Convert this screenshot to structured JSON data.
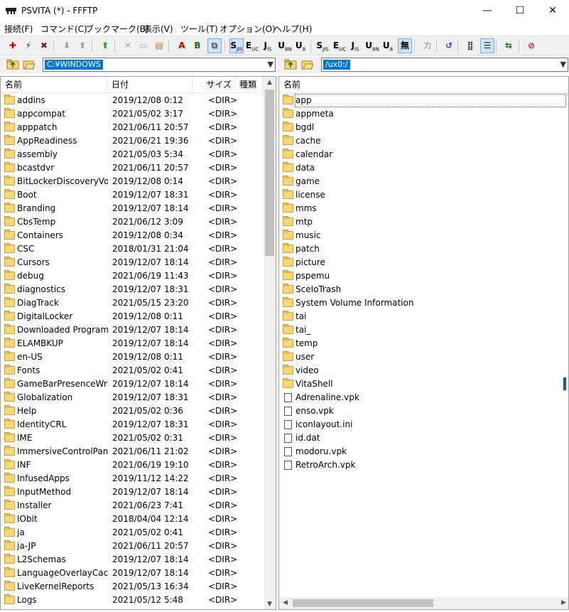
{
  "window": {
    "title": "PSVITA (*) - FFFTP",
    "min_glyph": "—",
    "max_glyph": "☐",
    "close_glyph": "✕"
  },
  "menu": [
    "接続(F)",
    "コマンド(C)",
    "ブックマーク(B)",
    "表示(V)",
    "ツール(T)",
    "オプション(O)",
    "ヘルプ(H)"
  ],
  "toolbar": {
    "buttons": [
      {
        "name": "connect-icon",
        "glyph": "✚",
        "color": "#c00000"
      },
      {
        "name": "quick-connect-icon",
        "glyph": "⚡",
        "color": "#333333"
      },
      {
        "name": "disconnect-icon",
        "glyph": "✖",
        "color": "#8b1a1a"
      },
      {
        "name": "download-icon",
        "glyph": "⬇",
        "color": "#9a9a9a"
      },
      {
        "name": "upload-icon",
        "glyph": "⬆",
        "color": "#9a9a9a"
      },
      {
        "name": "mirror-upload-icon",
        "glyph": "⬆",
        "color": "#1e9a2e"
      },
      {
        "name": "delete-icon",
        "glyph": "✕",
        "color": "#a9a9a9"
      },
      {
        "name": "rename-icon",
        "glyph": "▭",
        "color": "#a9a9a9"
      },
      {
        "name": "mkdir-icon",
        "glyph": "▤",
        "color": "#a08020"
      },
      {
        "name": "ascii-mode-icon",
        "glyph": "A",
        "color": "#c00000"
      },
      {
        "name": "binary-mode-icon",
        "glyph": "B",
        "color": "#1a6a1a"
      },
      {
        "name": "auto-mode-icon",
        "glyph": "⧉",
        "color": "#555555"
      },
      {
        "name": "sjis-icon",
        "glyph": "S",
        "sub": "JIS",
        "color": "#000000"
      },
      {
        "name": "euc-icon",
        "glyph": "E",
        "sub": "UC",
        "color": "#000000"
      },
      {
        "name": "jis-icon",
        "glyph": "J",
        "sub": "IS",
        "color": "#000000"
      },
      {
        "name": "utf8n-icon",
        "glyph": "U",
        "sub": "8N",
        "color": "#000000"
      },
      {
        "name": "utf8-icon",
        "glyph": "U",
        "sub": "8",
        "color": "#000000"
      },
      {
        "name": "local-sjis-icon",
        "glyph": "S",
        "sub": "JIS",
        "color": "#000000"
      },
      {
        "name": "local-euc-icon",
        "glyph": "E",
        "sub": "UC",
        "color": "#000000"
      },
      {
        "name": "local-jis-icon",
        "glyph": "J",
        "sub": "IS",
        "color": "#000000"
      },
      {
        "name": "local-utf8n-icon",
        "glyph": "U",
        "sub": "8N",
        "color": "#000000"
      },
      {
        "name": "local-utf8-icon",
        "glyph": "U",
        "sub": "8",
        "color": "#000000"
      },
      {
        "name": "no-convert-icon",
        "glyph": "無",
        "color": "#000000"
      },
      {
        "name": "kana-convert-icon",
        "glyph": "カ",
        "color": "#a9a9a9"
      },
      {
        "name": "refresh-icon",
        "glyph": "↺",
        "color": "#1f4e9a"
      },
      {
        "name": "list-view-icon",
        "glyph": "⣿",
        "color": "#333333"
      },
      {
        "name": "detail-view-icon",
        "glyph": "☰",
        "color": "#333333"
      },
      {
        "name": "sync-browse-icon",
        "glyph": "⇆",
        "color": "#1a6a1a"
      },
      {
        "name": "stop-icon",
        "glyph": "⊘",
        "color": "#d01010"
      }
    ]
  },
  "local": {
    "path": "C:¥WINDOWS",
    "columns": [
      "名前",
      "日付",
      "サイズ",
      "種類"
    ],
    "rows": [
      [
        "addins",
        "2019/12/08  0:12",
        "<DIR>"
      ],
      [
        "appcompat",
        "2021/05/02  3:17",
        "<DIR>"
      ],
      [
        "apppatch",
        "2021/06/11 20:57",
        "<DIR>"
      ],
      [
        "AppReadiness",
        "2021/06/21 19:36",
        "<DIR>"
      ],
      [
        "assembly",
        "2021/05/03  5:34",
        "<DIR>"
      ],
      [
        "bcastdvr",
        "2021/06/11 20:57",
        "<DIR>"
      ],
      [
        "BitLockerDiscoveryVol...",
        "2019/12/08  0:14",
        "<DIR>"
      ],
      [
        "Boot",
        "2019/12/07 18:31",
        "<DIR>"
      ],
      [
        "Branding",
        "2019/12/07 18:14",
        "<DIR>"
      ],
      [
        "CbsTemp",
        "2021/06/12  3:09",
        "<DIR>"
      ],
      [
        "Containers",
        "2019/12/08  0:34",
        "<DIR>"
      ],
      [
        "CSC",
        "2018/01/31 21:04",
        "<DIR>"
      ],
      [
        "Cursors",
        "2019/12/07 18:14",
        "<DIR>"
      ],
      [
        "debug",
        "2021/06/19 11:43",
        "<DIR>"
      ],
      [
        "diagnostics",
        "2019/12/07 18:31",
        "<DIR>"
      ],
      [
        "DiagTrack",
        "2021/05/15 23:20",
        "<DIR>"
      ],
      [
        "DigitalLocker",
        "2019/12/08  0:11",
        "<DIR>"
      ],
      [
        "Downloaded Program...",
        "2019/12/07 18:14",
        "<DIR>"
      ],
      [
        "ELAMBKUP",
        "2019/12/07 18:14",
        "<DIR>"
      ],
      [
        "en-US",
        "2019/12/08  0:11",
        "<DIR>"
      ],
      [
        "Fonts",
        "2021/05/02  0:41",
        "<DIR>"
      ],
      [
        "GameBarPresenceWriter",
        "2019/12/07 18:14",
        "<DIR>"
      ],
      [
        "Globalization",
        "2019/12/07 18:31",
        "<DIR>"
      ],
      [
        "Help",
        "2021/05/02  0:36",
        "<DIR>"
      ],
      [
        "IdentityCRL",
        "2019/12/07 18:31",
        "<DIR>"
      ],
      [
        "IME",
        "2021/05/02  0:31",
        "<DIR>"
      ],
      [
        "ImmersiveControlPanel",
        "2021/06/11 21:02",
        "<DIR>"
      ],
      [
        "INF",
        "2021/06/19 19:10",
        "<DIR>"
      ],
      [
        "InfusedApps",
        "2019/11/12 14:22",
        "<DIR>"
      ],
      [
        "InputMethod",
        "2019/12/07 18:14",
        "<DIR>"
      ],
      [
        "Installer",
        "2021/06/23  7:41",
        "<DIR>"
      ],
      [
        "IObit",
        "2018/04/04 12:14",
        "<DIR>"
      ],
      [
        "ja",
        "2021/05/02  0:41",
        "<DIR>"
      ],
      [
        "ja-JP",
        "2021/06/11 20:57",
        "<DIR>"
      ],
      [
        "L2Schemas",
        "2019/12/07 18:14",
        "<DIR>"
      ],
      [
        "LanguageOverlayCache",
        "2019/12/07 18:14",
        "<DIR>"
      ],
      [
        "LiveKernelReports",
        "2021/05/13 16:34",
        "<DIR>"
      ],
      [
        "Logs",
        "2021/05/12  5:48",
        "<DIR>"
      ]
    ]
  },
  "remote": {
    "path": "/ux0:/",
    "columns": [
      "名前"
    ],
    "rows": [
      {
        "name": "app",
        "type": "folder"
      },
      {
        "name": "appmeta",
        "type": "folder"
      },
      {
        "name": "bgdl",
        "type": "folder"
      },
      {
        "name": "cache",
        "type": "folder"
      },
      {
        "name": "calendar",
        "type": "folder"
      },
      {
        "name": "data",
        "type": "folder"
      },
      {
        "name": "game",
        "type": "folder"
      },
      {
        "name": "license",
        "type": "folder"
      },
      {
        "name": "mms",
        "type": "folder"
      },
      {
        "name": "mtp",
        "type": "folder"
      },
      {
        "name": "music",
        "type": "folder"
      },
      {
        "name": "patch",
        "type": "folder"
      },
      {
        "name": "picture",
        "type": "folder"
      },
      {
        "name": "pspemu",
        "type": "folder"
      },
      {
        "name": "SceIoTrash",
        "type": "folder"
      },
      {
        "name": "System Volume Information",
        "type": "folder"
      },
      {
        "name": "tai",
        "type": "folder"
      },
      {
        "name": "tai_",
        "type": "folder"
      },
      {
        "name": "temp",
        "type": "folder"
      },
      {
        "name": "user",
        "type": "folder"
      },
      {
        "name": "video",
        "type": "folder"
      },
      {
        "name": "VitaShell",
        "type": "folder"
      },
      {
        "name": "Adrenaline.vpk",
        "type": "file"
      },
      {
        "name": "enso.vpk",
        "type": "file"
      },
      {
        "name": "iconlayout.ini",
        "type": "file"
      },
      {
        "name": "id.dat",
        "type": "file"
      },
      {
        "name": "modoru.vpk",
        "type": "file"
      },
      {
        "name": "RetroArch.vpk",
        "type": "file"
      }
    ]
  }
}
